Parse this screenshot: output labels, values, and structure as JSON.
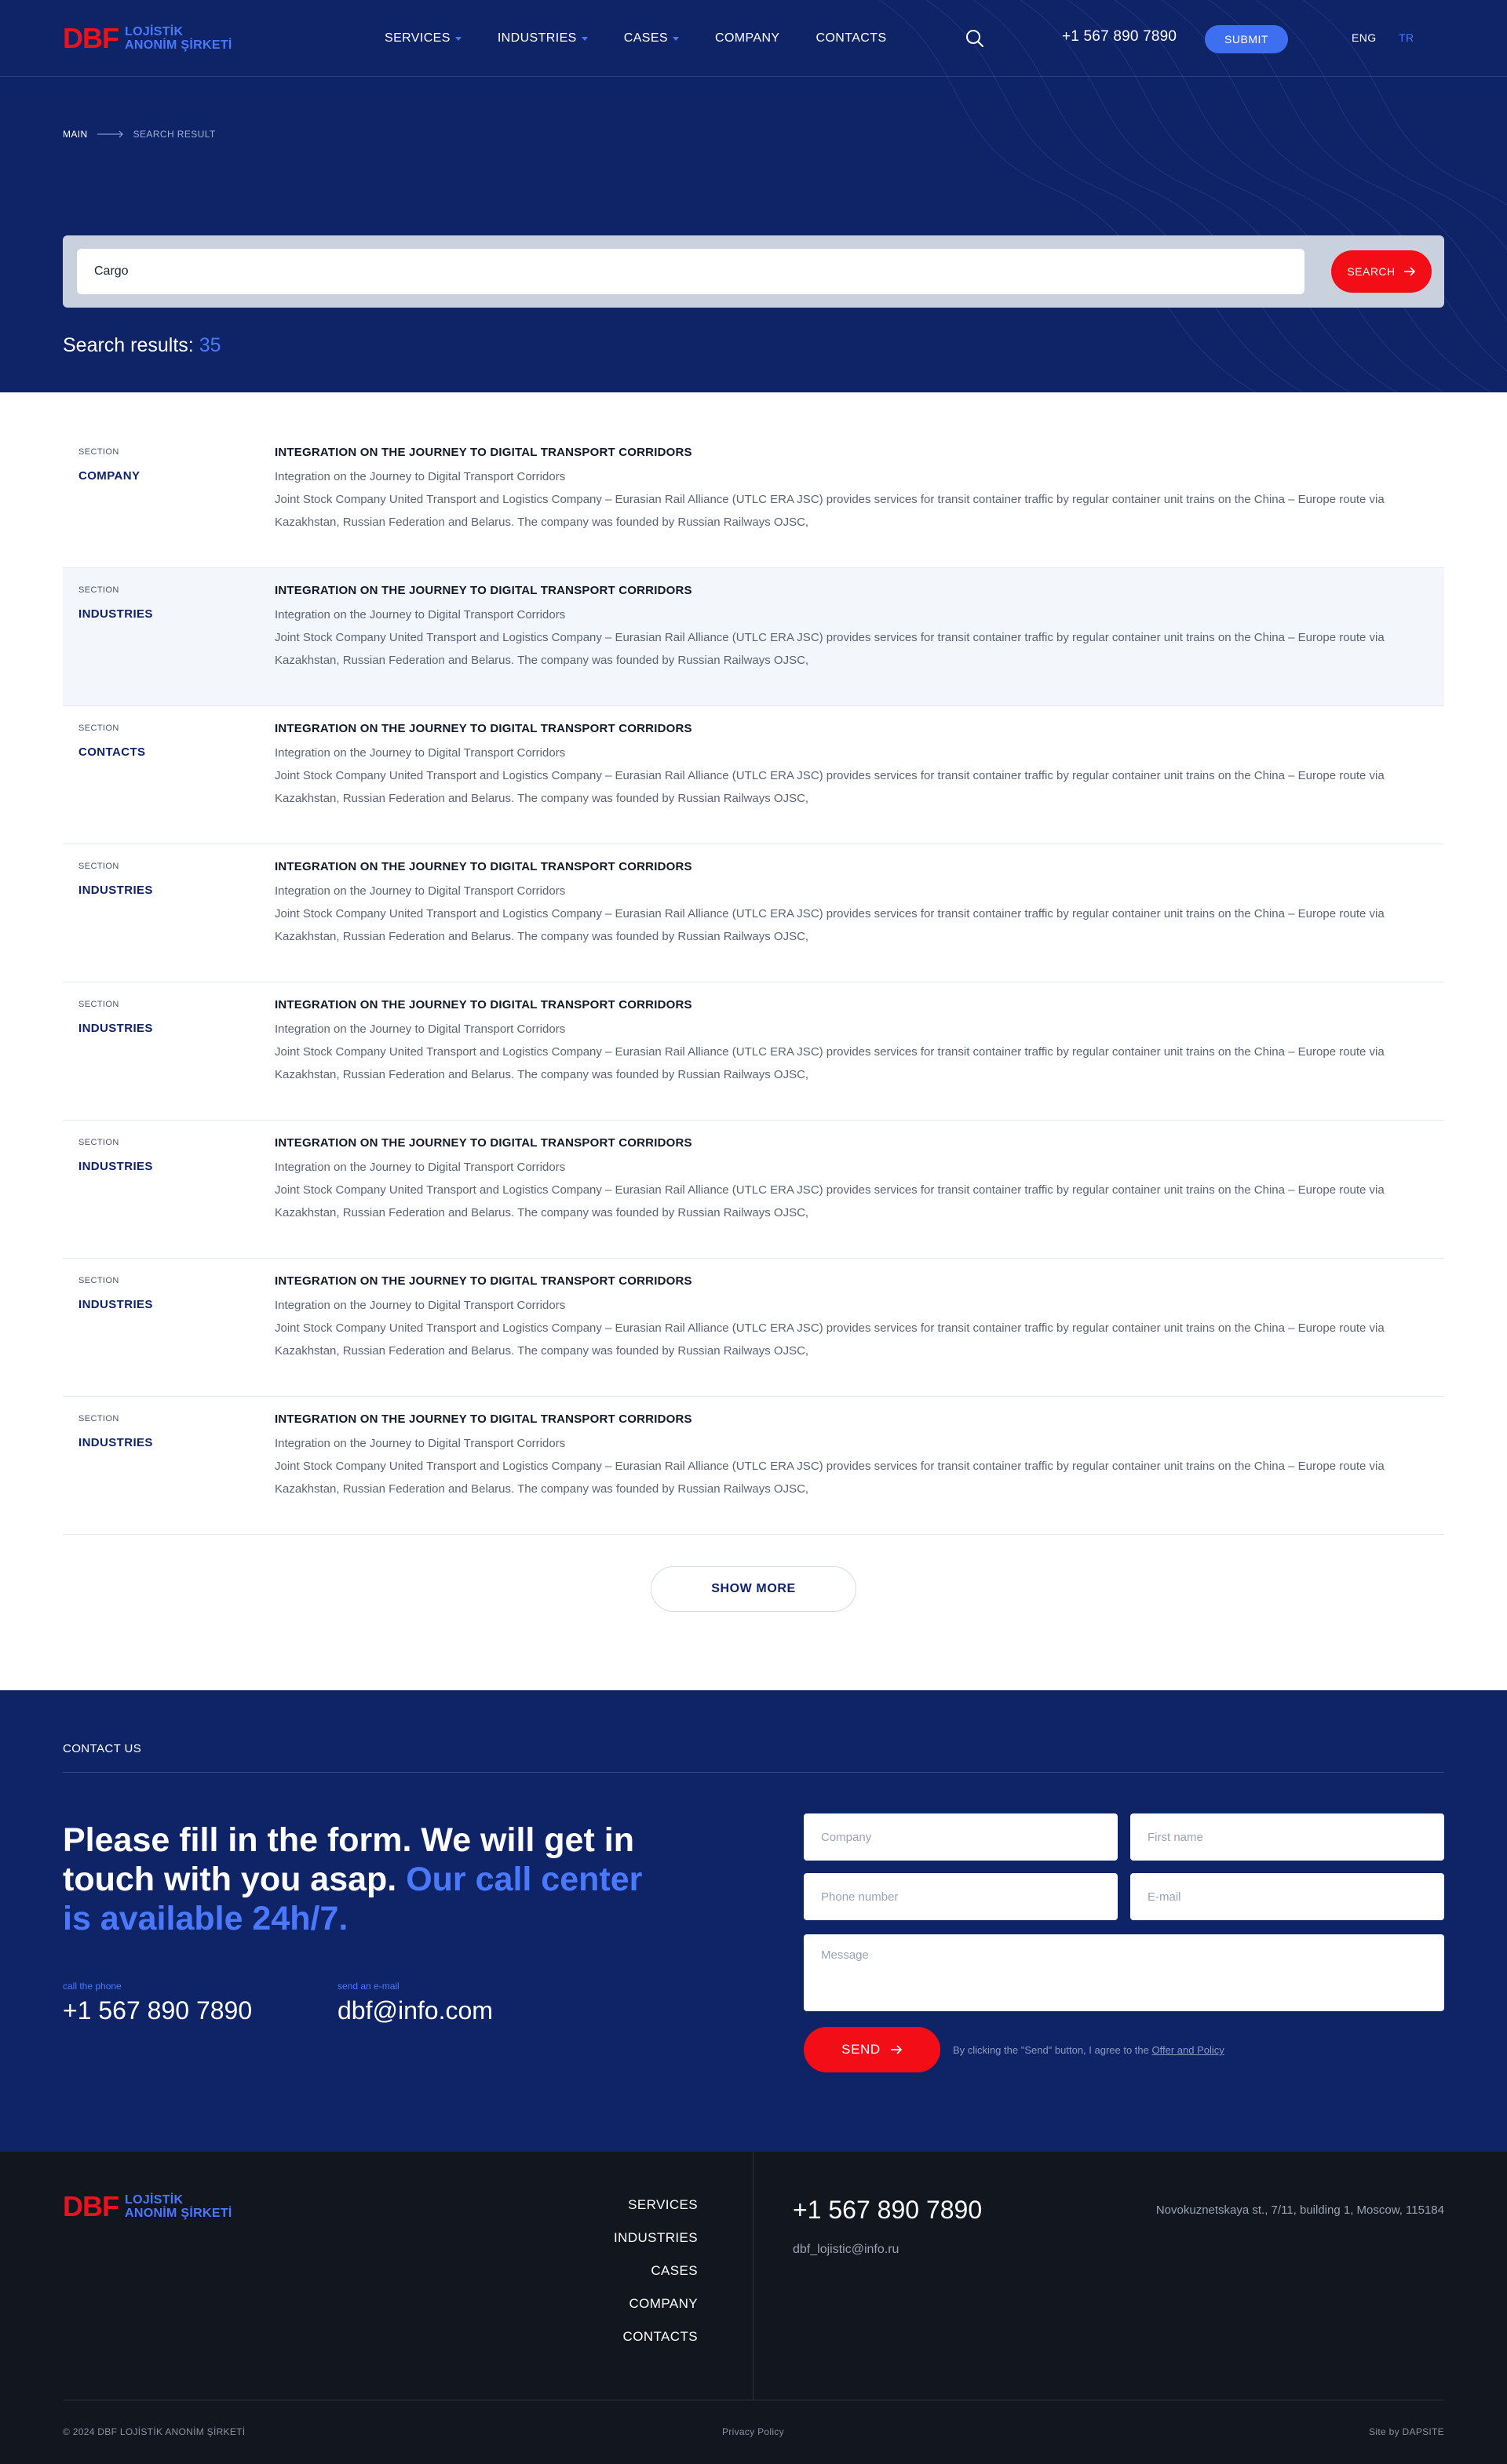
{
  "brand": {
    "mark": "DBF",
    "line1": "LOJİSTİK",
    "line2": "ANONİM ŞİRKETİ"
  },
  "nav": {
    "items": [
      {
        "label": "SERVICES",
        "dropdown": true
      },
      {
        "label": "INDUSTRIES",
        "dropdown": true
      },
      {
        "label": "CASES",
        "dropdown": true
      },
      {
        "label": "COMPANY",
        "dropdown": false
      },
      {
        "label": "CONTACTS",
        "dropdown": false
      }
    ],
    "phone": "+1 567 890 7890",
    "submit_label": "SUBMIT",
    "lang_eng": "ENG",
    "lang_tr": "TR"
  },
  "breadcrumb": {
    "main": "MAIN",
    "current": "SEARCH RESULT"
  },
  "search": {
    "value": "Cargo",
    "button_label": "SEARCH",
    "results_label": "Search results:",
    "results_count": "35"
  },
  "results": [
    {
      "section_label": "SECTION",
      "section": "COMPANY",
      "title": "INTEGRATION ON THE JOURNEY TO DIGITAL TRANSPORT CORRIDORS",
      "subtitle": "Integration on the Journey to Digital Transport Corridors",
      "text": "Joint Stock Company United Transport and Logistics Company – Eurasian Rail Alliance (UTLC ERA JSC) provides services for transit container traffic by regular container unit trains on the China – Europe route via Kazakhstan, Russian Federation and Belarus. The company was founded by Russian Railways OJSC,",
      "highlight": false
    },
    {
      "section_label": "SECTION",
      "section": "INDUSTRIES",
      "title": "INTEGRATION ON THE JOURNEY TO DIGITAL TRANSPORT CORRIDORS",
      "subtitle": "Integration on the Journey to Digital Transport Corridors",
      "text": "Joint Stock Company United Transport and Logistics Company – Eurasian Rail Alliance (UTLC ERA JSC) provides services for transit container traffic by regular container unit trains on the China – Europe route via Kazakhstan, Russian Federation and Belarus. The company was founded by Russian Railways OJSC,",
      "highlight": true
    },
    {
      "section_label": "SECTION",
      "section": "CONTACTS",
      "title": "INTEGRATION ON THE JOURNEY TO DIGITAL TRANSPORT CORRIDORS",
      "subtitle": "Integration on the Journey to Digital Transport Corridors",
      "text": "Joint Stock Company United Transport and Logistics Company – Eurasian Rail Alliance (UTLC ERA JSC) provides services for transit container traffic by regular container unit trains on the China – Europe route via Kazakhstan, Russian Federation and Belarus. The company was founded by Russian Railways OJSC,",
      "highlight": false
    },
    {
      "section_label": "SECTION",
      "section": "INDUSTRIES",
      "title": "INTEGRATION ON THE JOURNEY TO DIGITAL TRANSPORT CORRIDORS",
      "subtitle": "Integration on the Journey to Digital Transport Corridors",
      "text": "Joint Stock Company United Transport and Logistics Company – Eurasian Rail Alliance (UTLC ERA JSC) provides services for transit container traffic by regular container unit trains on the China – Europe route via Kazakhstan, Russian Federation and Belarus. The company was founded by Russian Railways OJSC,",
      "highlight": false
    },
    {
      "section_label": "SECTION",
      "section": "INDUSTRIES",
      "title": "INTEGRATION ON THE JOURNEY TO DIGITAL TRANSPORT CORRIDORS",
      "subtitle": "Integration on the Journey to Digital Transport Corridors",
      "text": "Joint Stock Company United Transport and Logistics Company – Eurasian Rail Alliance (UTLC ERA JSC) provides services for transit container traffic by regular container unit trains on the China – Europe route via Kazakhstan, Russian Federation and Belarus. The company was founded by Russian Railways OJSC,",
      "highlight": false
    },
    {
      "section_label": "SECTION",
      "section": "INDUSTRIES",
      "title": "INTEGRATION ON THE JOURNEY TO DIGITAL TRANSPORT CORRIDORS",
      "subtitle": "Integration on the Journey to Digital Transport Corridors",
      "text": "Joint Stock Company United Transport and Logistics Company – Eurasian Rail Alliance (UTLC ERA JSC) provides services for transit container traffic by regular container unit trains on the China – Europe route via Kazakhstan, Russian Federation and Belarus. The company was founded by Russian Railways OJSC,",
      "highlight": false
    },
    {
      "section_label": "SECTION",
      "section": "INDUSTRIES",
      "title": "INTEGRATION ON THE JOURNEY TO DIGITAL TRANSPORT CORRIDORS",
      "subtitle": "Integration on the Journey to Digital Transport Corridors",
      "text": "Joint Stock Company United Transport and Logistics Company – Eurasian Rail Alliance (UTLC ERA JSC) provides services for transit container traffic by regular container unit trains on the China – Europe route via Kazakhstan, Russian Federation and Belarus. The company was founded by Russian Railways OJSC,",
      "highlight": false
    },
    {
      "section_label": "SECTION",
      "section": "INDUSTRIES",
      "title": "INTEGRATION ON THE JOURNEY TO DIGITAL TRANSPORT CORRIDORS",
      "subtitle": "Integration on the Journey to Digital Transport Corridors",
      "text": "Joint Stock Company United Transport and Logistics Company – Eurasian Rail Alliance (UTLC ERA JSC) provides services for transit container traffic by regular container unit trains on the China – Europe route via Kazakhstan, Russian Federation and Belarus. The company was founded by Russian Railways OJSC,",
      "highlight": false
    }
  ],
  "show_more_label": "SHOW MORE",
  "contact": {
    "label": "CONTACT US",
    "heading_main": "Please fill in the form. We will get in touch with you asap.",
    "heading_accent": "Our call center is available 24h/7.",
    "phone_label": "call the phone",
    "phone": "+1 567 890 7890",
    "email_label": "send an e-mail",
    "email": "dbf@info.com",
    "form": {
      "company_placeholder": "Company",
      "first_name_placeholder": "First name",
      "phone_placeholder": "Phone number",
      "email_placeholder": "E-mail",
      "message_placeholder": "Message",
      "send_label": "SEND",
      "agree_text": "By clicking the \"Send\" button, I agree to the",
      "agree_link": "Offer and Policy"
    }
  },
  "footer": {
    "links": [
      "SERVICES",
      "INDUSTRIES",
      "CASES",
      "COMPANY",
      "CONTACTS"
    ],
    "phone": "+1 567 890 7890",
    "email": "dbf_lojistic@info.ru",
    "address": "Novokuznetskaya st., 7/11, building 1, Moscow, 115184",
    "copyright": "© 2024 DBF LOJİSTİK ANONİM ŞİRKETİ",
    "privacy": "Privacy Policy",
    "site_by": "Site by DAPSITE"
  },
  "colors": {
    "navy": "#0f2467",
    "accent_blue": "#4a78ff",
    "button_blue": "#3d6ff0",
    "red": "#f20d17",
    "footer_dark": "#12161f"
  },
  "icons": {
    "search": "magnifier",
    "arrow": "arrow-right",
    "breadcrumb_arrow": "long-arrow-right",
    "dropdown": "caret-down"
  }
}
